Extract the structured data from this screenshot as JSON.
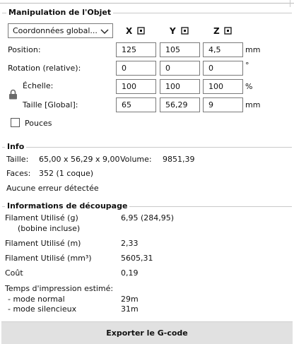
{
  "object_manipulation": {
    "title": "Manipulation de l'Objet",
    "coord_select": "Coordonnées global...",
    "axes": [
      "X",
      "Y",
      "Z"
    ],
    "rows": [
      {
        "label": "Position:",
        "values": [
          "125",
          "105",
          "4,5"
        ],
        "unit": "mm"
      },
      {
        "label": "Rotation (relative):",
        "values": [
          "0",
          "0",
          "0"
        ],
        "unit": "°"
      },
      {
        "label": "Échelle:",
        "values": [
          "100",
          "100",
          "100"
        ],
        "unit": "%"
      },
      {
        "label": "Taille [Global]:",
        "values": [
          "65",
          "56,29",
          "9"
        ],
        "unit": "mm"
      }
    ],
    "inches_label": "Pouces"
  },
  "info": {
    "title": "Info",
    "size_label": "Taille:",
    "size_value": "65,00 x 56,29 x 9,00",
    "volume_label": "Volume:",
    "volume_value": "9851,39",
    "faces_label": "Faces:",
    "faces_value": "352 (1 coque)",
    "errors": "Aucune erreur détectée"
  },
  "slicing": {
    "title": "Informations de découpage",
    "filament_g_label": "Filament Utilisé (g)",
    "filament_g_sub": "(bobine incluse)",
    "filament_g_value": "6,95 (284,95)",
    "filament_m_label": "Filament Utilisé (m)",
    "filament_m_value": "2,33",
    "filament_mm3_label": "Filament Utilisé (mm³)",
    "filament_mm3_value": "5605,31",
    "cost_label": "Coût",
    "cost_value": "0,19",
    "print_time_label": "Temps d'impression estimé:",
    "normal_mode_label": "- mode normal",
    "normal_mode_value": "29m",
    "silent_mode_label": "- mode silencieux",
    "silent_mode_value": "31m"
  },
  "export_button": "Exporter le G-code"
}
